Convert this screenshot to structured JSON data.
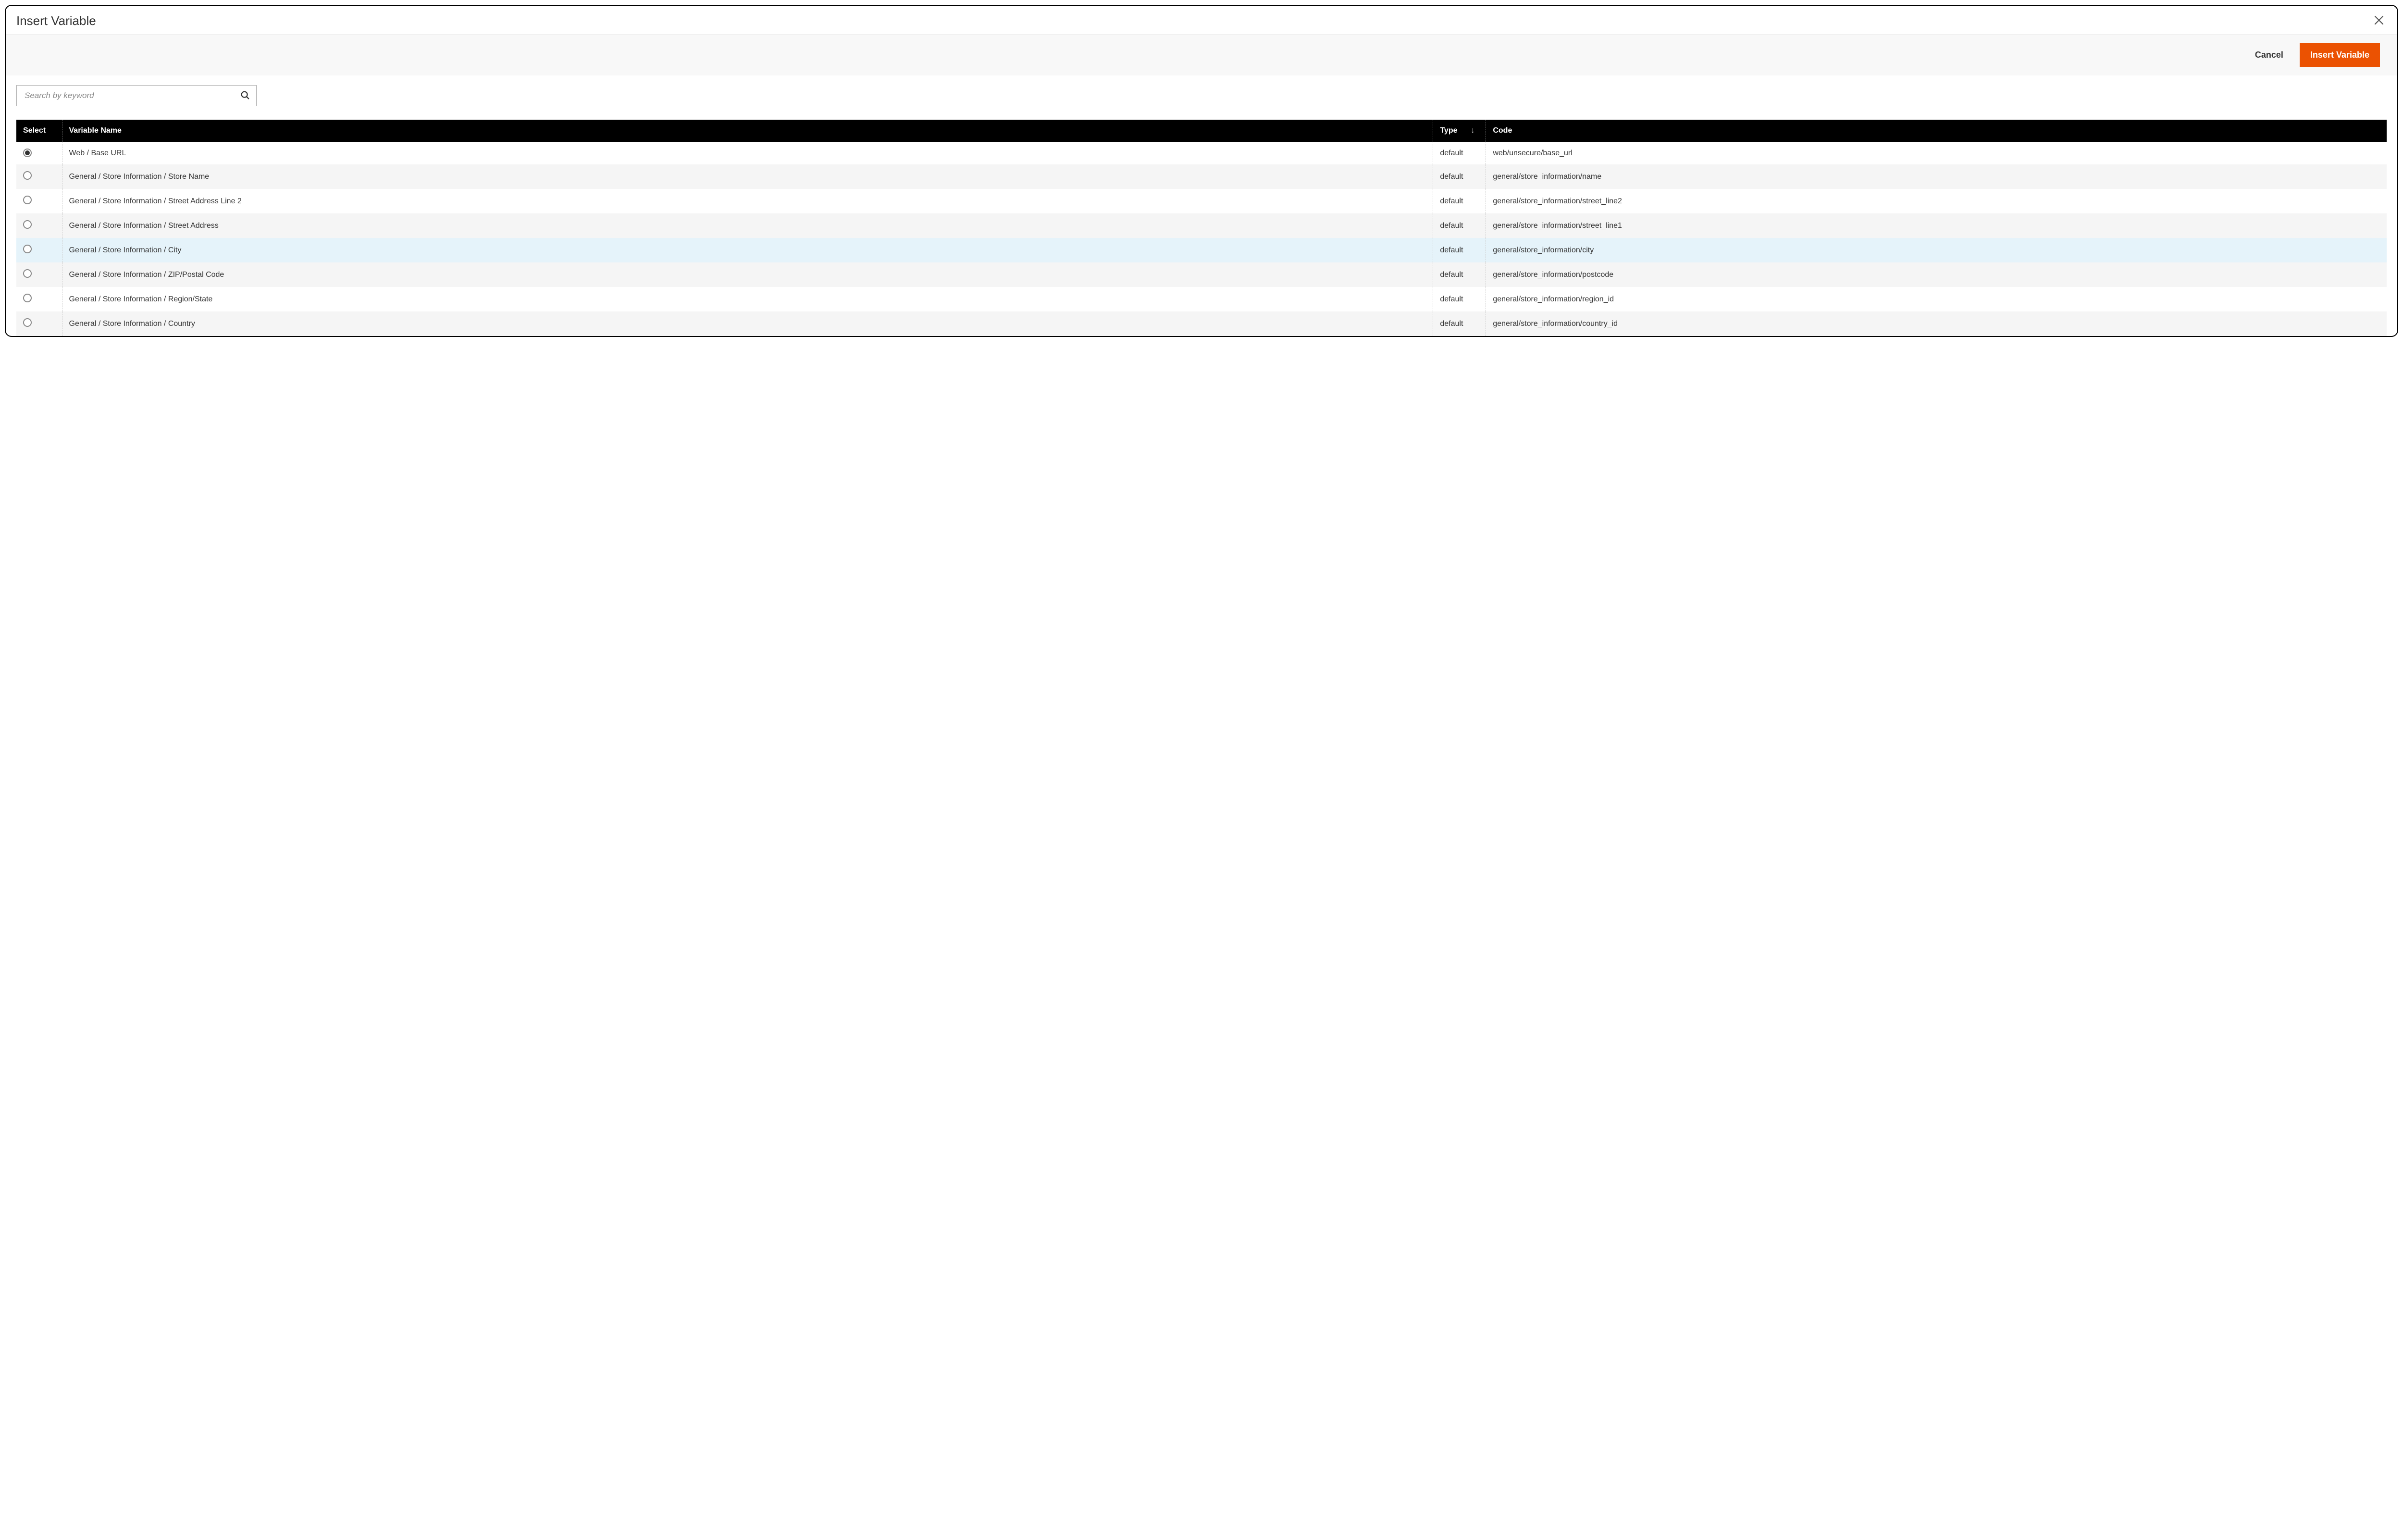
{
  "modal": {
    "title": "Insert Variable"
  },
  "actions": {
    "cancel": "Cancel",
    "insert": "Insert Variable"
  },
  "search": {
    "placeholder": "Search by keyword",
    "value": ""
  },
  "table": {
    "headers": {
      "select": "Select",
      "name": "Variable Name",
      "type": "Type",
      "code": "Code"
    },
    "sort_indicator": "↓",
    "rows": [
      {
        "selected": true,
        "hovered": false,
        "name": "Web / Base URL",
        "type": "default",
        "code": "web/unsecure/base_url"
      },
      {
        "selected": false,
        "hovered": false,
        "name": "General / Store Information / Store Name",
        "type": "default",
        "code": "general/store_information/name"
      },
      {
        "selected": false,
        "hovered": false,
        "name": "General / Store Information / Street Address Line 2",
        "type": "default",
        "code": "general/store_information/street_line2"
      },
      {
        "selected": false,
        "hovered": false,
        "name": "General / Store Information / Street Address",
        "type": "default",
        "code": "general/store_information/street_line1"
      },
      {
        "selected": false,
        "hovered": true,
        "name": "General / Store Information / City",
        "type": "default",
        "code": "general/store_information/city"
      },
      {
        "selected": false,
        "hovered": false,
        "name": "General / Store Information / ZIP/Postal Code",
        "type": "default",
        "code": "general/store_information/postcode"
      },
      {
        "selected": false,
        "hovered": false,
        "name": "General / Store Information / Region/State",
        "type": "default",
        "code": "general/store_information/region_id"
      },
      {
        "selected": false,
        "hovered": false,
        "name": "General / Store Information / Country",
        "type": "default",
        "code": "general/store_information/country_id"
      }
    ]
  }
}
